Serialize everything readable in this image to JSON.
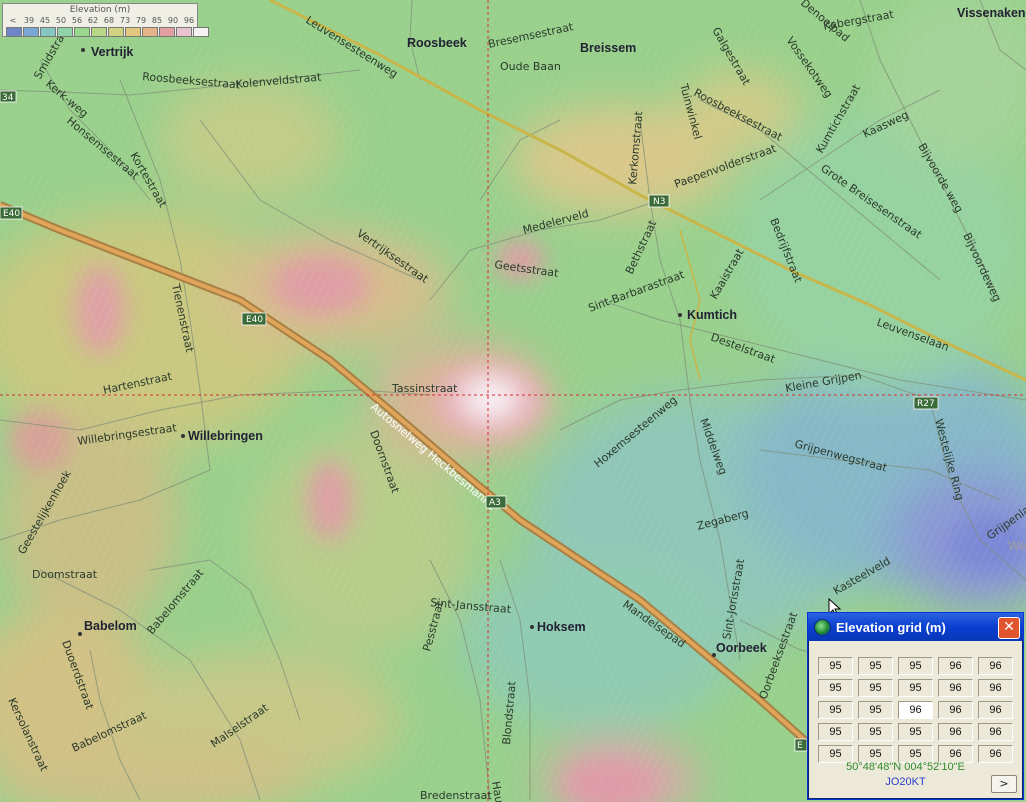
{
  "legend": {
    "title": "Elevation (m)",
    "ticks": [
      "<",
      "39",
      "45",
      "50",
      "56",
      "62",
      "68",
      "73",
      "79",
      "85",
      "90",
      "96"
    ],
    "colors": [
      "#6e86c8",
      "#7aa6d4",
      "#86c6c0",
      "#8fd4a8",
      "#9ad890",
      "#b7d886",
      "#d2d282",
      "#e2c87e",
      "#e6b486",
      "#e4a0a0",
      "#eac4cc",
      "#f4f0f4"
    ]
  },
  "map": {
    "towns": [
      "Vertrijk",
      "Roosbeek",
      "Breissem",
      "Vissenaken",
      "Kumtich",
      "Willebringen",
      "Hoksem",
      "Oorbeek",
      "Babelom",
      "We"
    ],
    "streets": [
      "Smidstraat",
      "Kerk-weg",
      "Roosbeeksestraat",
      "Kolenveldstraat",
      "Honsemsestraat",
      "Kortestraat",
      "Leuvensesteenweg",
      "Bresemsestraat",
      "Oude Baan",
      "Tuinwinkel",
      "Galgestraat",
      "Roosbeeksestraat",
      "Kerkomstraat",
      "Paepenvolderstraat",
      "Medelerveld",
      "Geetsstraat",
      "Sint-Barbarastraat",
      "Bethstraat",
      "Kaaistraat",
      "Vertrijksestraat",
      "Tienenstraat",
      "Tassinstraat",
      "Hartenstraat",
      "Willebringsestraat",
      "Doornstraat",
      "Autosnelweg Heckbesmanne",
      "Hoxemsesteenweg",
      "Middelweg",
      "Kleine Grijpen",
      "Grijpenwegstraat",
      "Zegaberg",
      "Sint-Jorisstraat",
      "Kasteelveld",
      "Sint-Jansstraat",
      "Pesstraat",
      "Blondstraat",
      "Geestelijkenhoek",
      "Doomstraat",
      "Babelomstraat",
      "Babelomstraat",
      "Duoerdstraat",
      "Oorbeeksestraat",
      "Denoelpad",
      "Kabergstraat",
      "Vossekotweg",
      "Kumtichstraat",
      "Kaasweg",
      "Grote Breisesenstraat",
      "Bijvoorde weg",
      "Bijvoordeweg",
      "Westelijke Ring",
      "Leuvenselaan",
      "Bedrijfstraat",
      "Destelstraat",
      "Malselstraat",
      "Mandelsepad",
      "Grijpenlaan",
      "Hauw",
      "Kersolanstraat",
      "Bredenstraat"
    ],
    "road_numbers": [
      "34",
      "E40",
      "E40",
      "N3",
      "R27",
      "A3",
      "E"
    ]
  },
  "dialog": {
    "title": "Elevation grid (m)",
    "close_label": "✕",
    "rows": [
      [
        "95",
        "95",
        "95",
        "96",
        "96"
      ],
      [
        "95",
        "95",
        "95",
        "96",
        "96"
      ],
      [
        "95",
        "95",
        "96",
        "96",
        "96"
      ],
      [
        "95",
        "95",
        "95",
        "96",
        "96"
      ],
      [
        "95",
        "95",
        "95",
        "96",
        "96"
      ]
    ],
    "coordinates": "50°48'48\"N  004°52'10\"E",
    "locator": "JO20KT",
    "next_label": ">"
  }
}
